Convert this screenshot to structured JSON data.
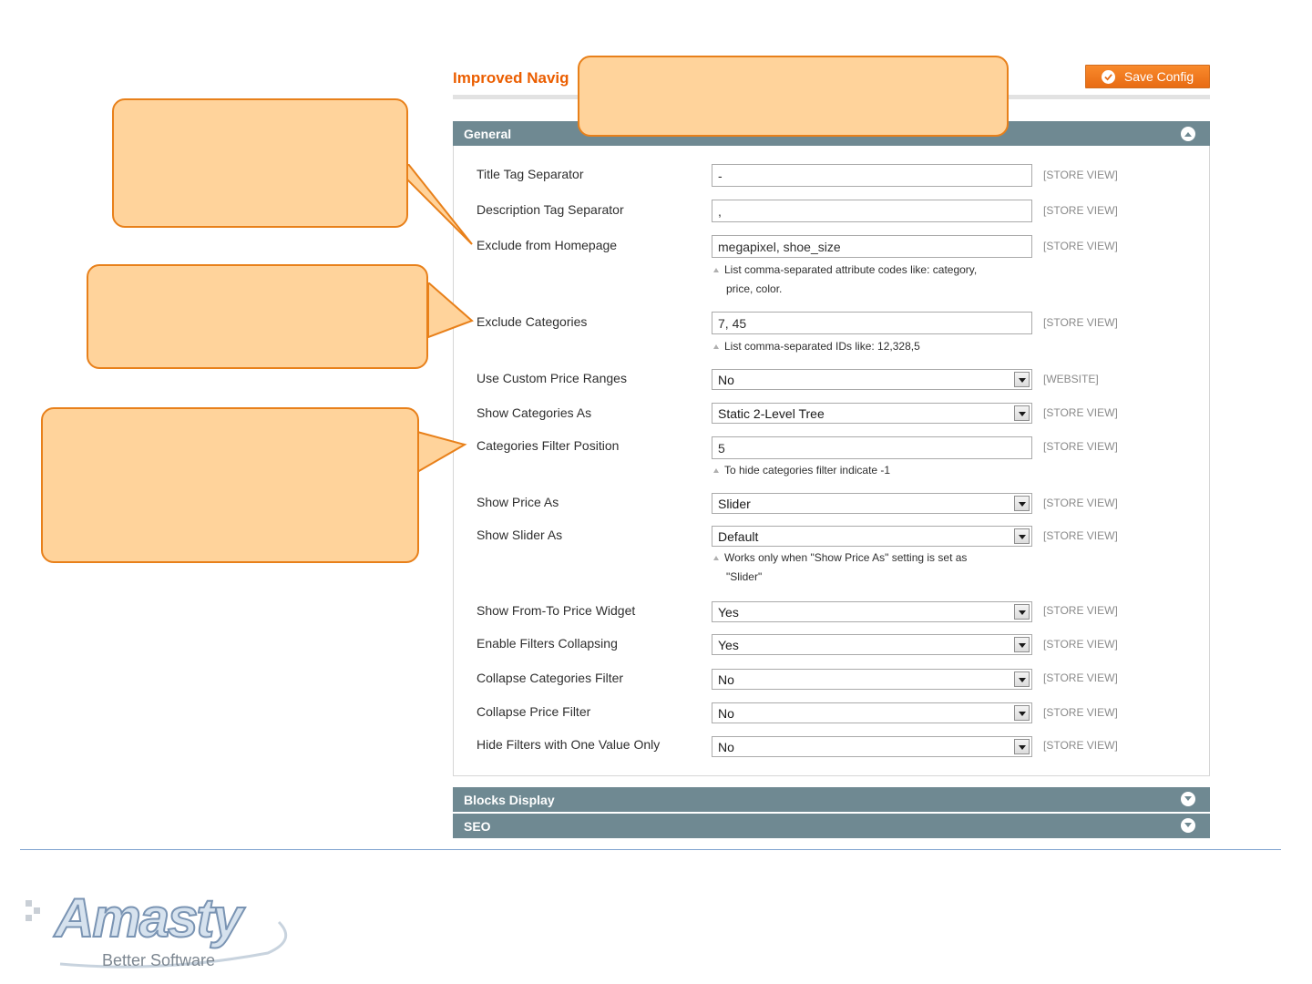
{
  "header": {
    "page_title": "Improved Navig",
    "save_button": "Save Config"
  },
  "general_section": {
    "title": "General",
    "fields": [
      {
        "label": "Title Tag Separator",
        "type": "text",
        "value": "-",
        "scope": "[STORE VIEW]"
      },
      {
        "label": "Description Tag Separator",
        "type": "text",
        "value": ",",
        "scope": "[STORE VIEW]"
      },
      {
        "label": "Exclude from Homepage",
        "type": "text",
        "value": "megapixel, shoe_size",
        "scope": "[STORE VIEW]",
        "note_line1": "List comma-separated attribute codes like: category,",
        "note_line2": "price, color."
      },
      {
        "label": "Exclude Categories",
        "type": "text",
        "value": "7, 45",
        "scope": "[STORE VIEW]",
        "note_line1": "List comma-separated IDs like: 12,328,5"
      },
      {
        "label": "Use Custom Price Ranges",
        "type": "select",
        "value": "No",
        "scope": "[WEBSITE]"
      },
      {
        "label": "Show Categories As",
        "type": "select",
        "value": "Static 2-Level Tree",
        "scope": "[STORE VIEW]"
      },
      {
        "label": "Categories Filter Position",
        "type": "text",
        "value": "5",
        "scope": "[STORE VIEW]",
        "note_line1": "To hide categories filter indicate -1"
      },
      {
        "label": "Show Price As",
        "type": "select",
        "value": "Slider",
        "scope": "[STORE VIEW]"
      },
      {
        "label": "Show Slider As",
        "type": "select",
        "value": "Default",
        "scope": "[STORE VIEW]",
        "note_line1": "Works only when \"Show Price As\" setting is set as",
        "note_line2": "\"Slider\""
      },
      {
        "label": "Show From-To Price Widget",
        "type": "select",
        "value": "Yes",
        "scope": "[STORE VIEW]"
      },
      {
        "label": "Enable Filters Collapsing",
        "type": "select",
        "value": "Yes",
        "scope": "[STORE VIEW]"
      },
      {
        "label": "Collapse Categories Filter",
        "type": "select",
        "value": "No",
        "scope": "[STORE VIEW]"
      },
      {
        "label": "Collapse Price Filter",
        "type": "select",
        "value": "No",
        "scope": "[STORE VIEW]"
      },
      {
        "label": "Hide Filters with One Value Only",
        "type": "select",
        "value": "No",
        "scope": "[STORE VIEW]"
      }
    ]
  },
  "sections": {
    "blocks_display": "Blocks Display",
    "seo": "SEO"
  },
  "logo": {
    "brand": "Amasty",
    "tagline": "Better Software"
  },
  "colors": {
    "accent": "#eb5e00",
    "section_header": "#6f8992",
    "callout_fill": "#ffd39b",
    "callout_border": "#e8801a"
  }
}
